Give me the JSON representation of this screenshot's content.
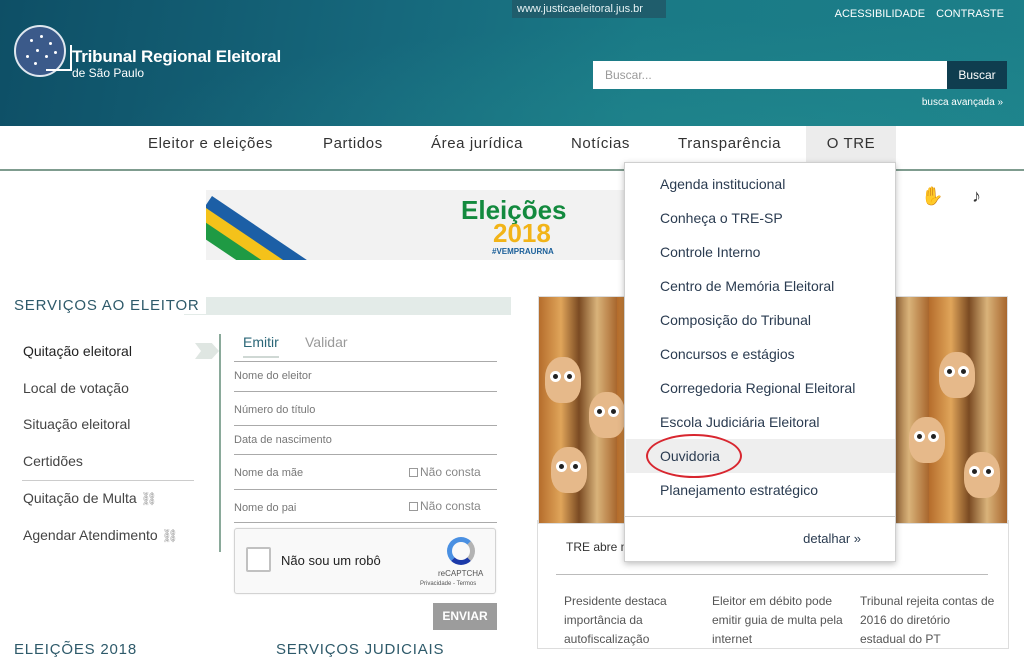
{
  "header": {
    "url": "www.justicaeleitoral.jus.br",
    "org_name": "Tribunal Regional Eleitoral",
    "org_sub": "de São Paulo",
    "accessibility": "ACESSIBILIDADE",
    "contrast": "CONTRASTE",
    "search_placeholder": "Buscar...",
    "search_button": "Buscar",
    "advanced_search": "busca avançada »"
  },
  "nav": {
    "items": [
      "Eleitor e eleições",
      "Partidos",
      "Área jurídica",
      "Notícias",
      "Transparência",
      "O TRE"
    ]
  },
  "banner": {
    "title": "Eleições",
    "year": "2018",
    "hashtag": "#VEMPRAURNA"
  },
  "services": {
    "title": "SERVIÇOS AO ELEITOR",
    "items": [
      "Quitação eleitoral",
      "Local de votação",
      "Situação eleitoral",
      "Certidões",
      "Quitação de Multa",
      "Agendar Atendimento"
    ],
    "tabs": [
      "Emitir",
      "Validar"
    ],
    "fields": [
      "Nome do eleitor",
      "Número do título",
      "Data de nascimento",
      "Nome da mãe",
      "Nome do pai"
    ],
    "not_listed": "Não consta",
    "captcha_label": "Não sou um robô",
    "captcha_brand": "reCAPTCHA",
    "captcha_terms": "Privacidade - Termos",
    "send": "ENVIAR",
    "bottom_left": "ELEIÇÕES 2018",
    "bottom_mid": "SERVIÇOS JUDICIAIS"
  },
  "dropdown": {
    "items": [
      "Agenda institucional",
      "Conheça o TRE-SP",
      "Controle Interno",
      "Centro de Memória Eleitoral",
      "Composição do Tribunal",
      "Concursos e estágios",
      "Corregedoria Regional Eleitoral",
      "Escola Judiciária Eleitoral",
      "Ouvidoria",
      "Planejamento estratégico"
    ],
    "more": "detalhar »"
  },
  "news": {
    "caption": "TRE abre m",
    "cols": [
      "Presidente destaca importância da autofiscalização",
      "Eleitor em débito pode emitir guia de multa pela internet",
      "Tribunal rejeita contas de 2016 do diretório estadual do PT"
    ]
  }
}
